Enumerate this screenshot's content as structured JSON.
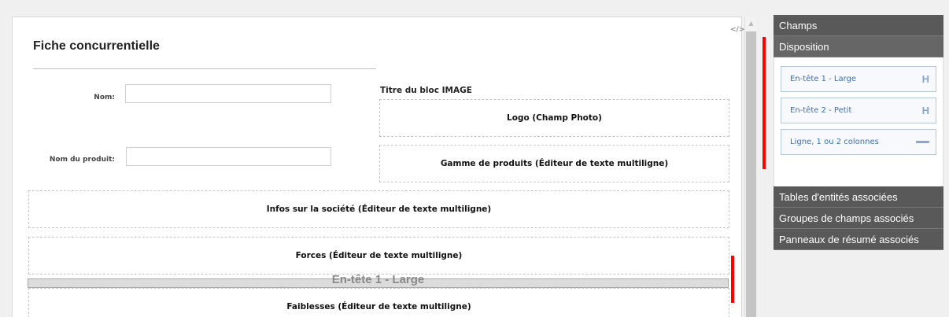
{
  "form": {
    "title": "Fiche concurrentielle",
    "fields": [
      {
        "label": "Nom:",
        "value": ""
      },
      {
        "label": "Nom du produit:",
        "value": ""
      }
    ],
    "image_block_title": "Titre du bloc IMAGE",
    "logo_placeholder": "Logo (Champ Photo)",
    "gamme_placeholder": "Gamme de produits (Éditeur de texte multiligne)",
    "infos_placeholder": "Infos sur la société (Éditeur de texte multiligne)",
    "forces_placeholder": "Forces (Éditeur de texte multiligne)",
    "faiblesses_placeholder": "Faiblesses (Éditeur de texte multiligne)",
    "drop_indicator": "En-tête 1 - Large",
    "source_icon": "</>"
  },
  "panel": {
    "champs": "Champs",
    "disposition": "Disposition",
    "layout_items": [
      {
        "label": "En-tête 1 - Large",
        "icon": "H"
      },
      {
        "label": "En-tête 2 - Petit",
        "icon": "H"
      },
      {
        "label": "Ligne, 1 ou 2 colonnes",
        "icon": "bar"
      }
    ],
    "tables": "Tables d'entités associées",
    "groupes": "Groupes de champs associés",
    "panneaux": "Panneaux de résumé associés"
  },
  "colors": {
    "panel_header": "#595959",
    "marker": "#ff0000",
    "layout_text": "#3f6fb0"
  }
}
